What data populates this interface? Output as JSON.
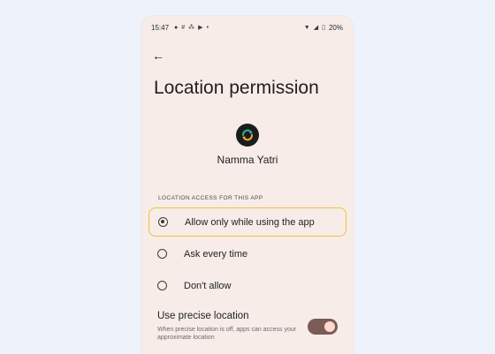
{
  "status_bar": {
    "time": "15:47",
    "battery": "20%",
    "icons": [
      "chat-bubble-icon",
      "grid-icon",
      "hash-icon",
      "youtube-icon",
      "dot-icon",
      "wifi-icon",
      "signal-icon",
      "battery-icon"
    ]
  },
  "header": {
    "title": "Location permission"
  },
  "app": {
    "name": "Namma Yatri",
    "icon": "sync-arrows-icon"
  },
  "location_section": {
    "label": "LOCATION ACCESS FOR THIS APP",
    "options": [
      {
        "label": "Allow only while using the app",
        "selected": true
      },
      {
        "label": "Ask every time",
        "selected": false
      },
      {
        "label": "Don't allow",
        "selected": false
      }
    ]
  },
  "precise": {
    "title": "Use precise location",
    "description": "When precise location is off, apps can access your approximate location",
    "enabled": true
  },
  "colors": {
    "background": "#eef2fb",
    "screen": "#f7ece8",
    "highlight": "#f1c13d",
    "toggle_track": "#7a5b55",
    "toggle_knob": "#ffd9cf"
  }
}
